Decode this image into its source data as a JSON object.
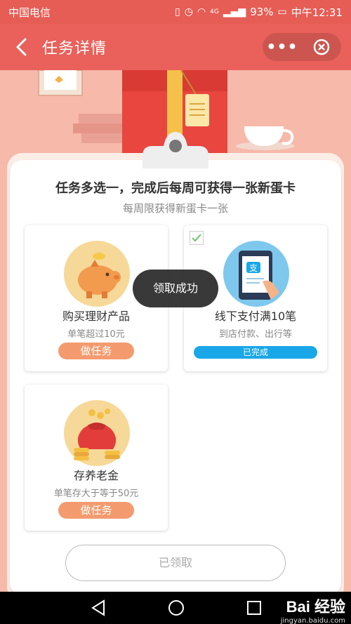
{
  "status_bar": {
    "carrier": "中国电信",
    "network": "4G",
    "battery": "93%",
    "time": "中午12:31"
  },
  "header": {
    "back_icon": "back-arrow-icon",
    "title": "任务详情",
    "more_icon": "more-icon",
    "close_icon": "close-target-icon"
  },
  "main": {
    "headline": "任务多选一，完成后每周可获得一张新蛋卡",
    "subline": "每周限获得新蛋卡一张",
    "tasks": [
      {
        "name": "购买理财产品",
        "desc": "单笔超过10元",
        "action": "做任务",
        "icon": "piggy-bank-icon",
        "checked": false
      },
      {
        "name": "线下支付满10笔",
        "desc": "到店付款、出行等",
        "action": "已完成",
        "icon": "alipay-payment-icon",
        "checked": true
      },
      {
        "name": "存养老金",
        "desc": "单笔存大于等于50元",
        "action": "做任务",
        "icon": "money-bag-icon",
        "checked": false
      }
    ],
    "toast": "领取成功",
    "claimed_button": "已领取"
  },
  "nav_bar": {
    "back_icon": "triangle-back-icon",
    "home_icon": "circle-home-icon",
    "recent_icon": "square-recent-icon"
  },
  "watermark": {
    "brand": "Bai 经验",
    "url": "jingyan.baidu.com"
  },
  "colors": {
    "header": "#e9615a",
    "background": "#f6b9aa",
    "task_button": "#f39b6e",
    "done_button": "#1aa7e8"
  }
}
